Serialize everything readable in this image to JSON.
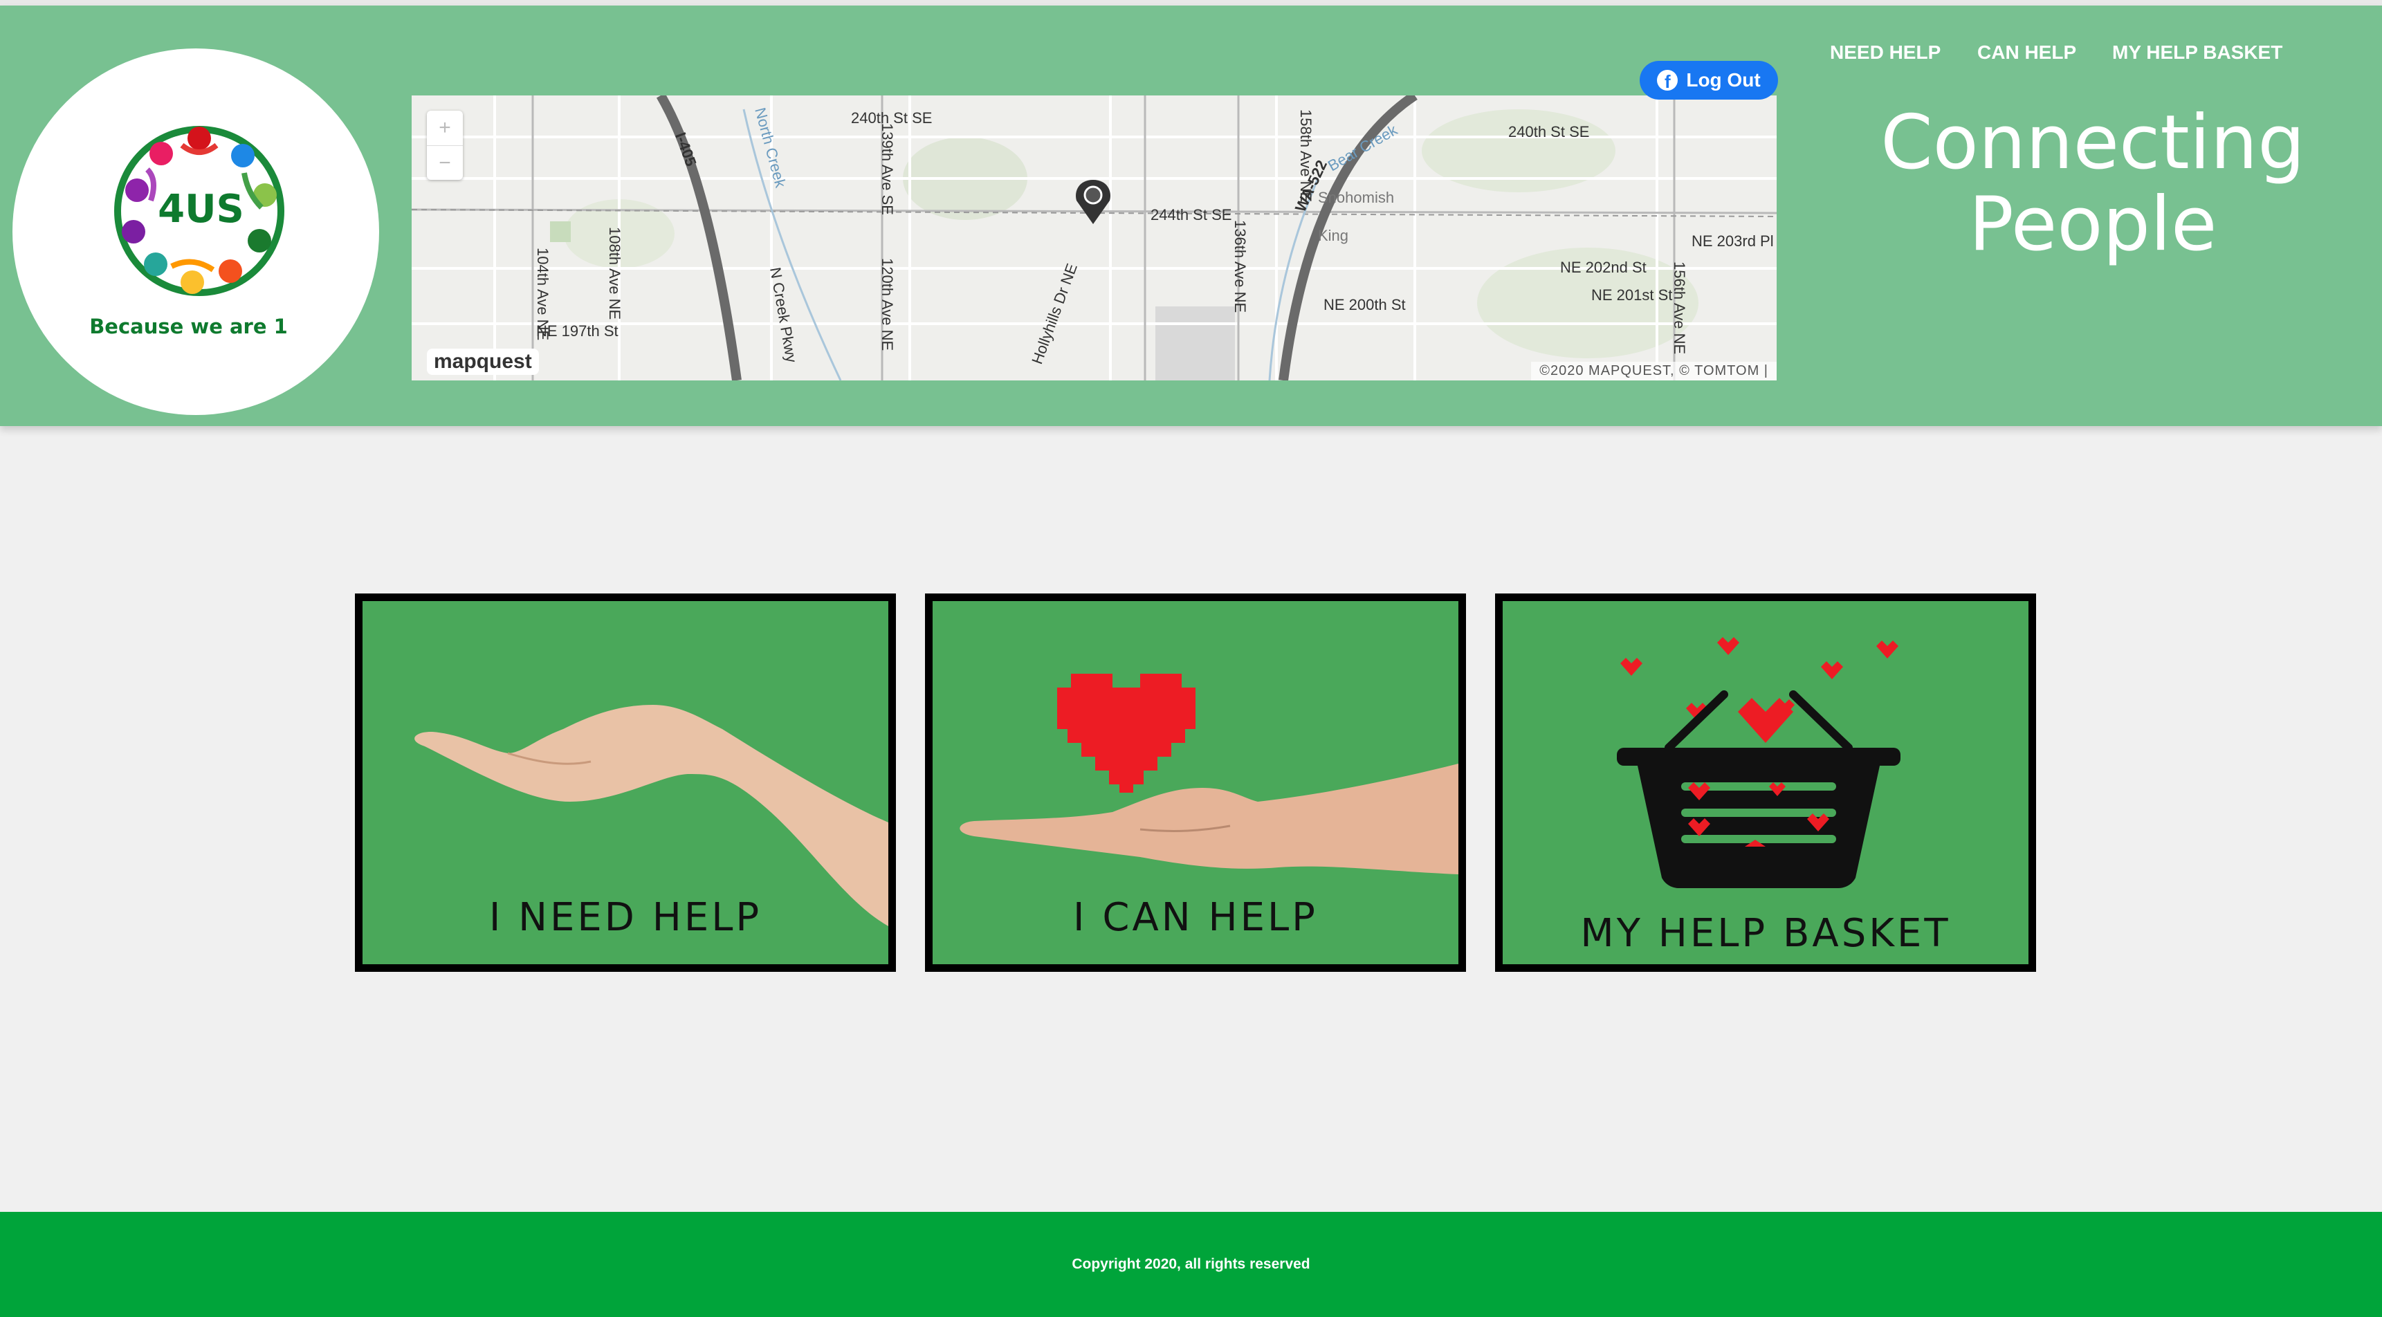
{
  "brand": {
    "logo_text": "4US",
    "tagline": "Because we are 1"
  },
  "nav": {
    "items": [
      "NEED HELP",
      "CAN HELP",
      "MY HELP BASKET"
    ]
  },
  "auth": {
    "logout_label": "Log Out",
    "logout_icon": "facebook-icon"
  },
  "headline": {
    "line1": "Connecting",
    "line2": "People"
  },
  "map": {
    "provider": "mapquest",
    "attribution": "©2020 MAPQUEST, © TOMTOM |",
    "zoom_in": "+",
    "zoom_out": "−",
    "labels": {
      "l1": "240th St SE",
      "l2": "240th St SE",
      "l3": "244th St SE",
      "l4": "I-405",
      "l5": "WA-522",
      "l6": "NE 203rd Pl",
      "l7": "NE 202nd St",
      "l8": "NE 201st St",
      "l9": "NE 200th St",
      "l10": "NE 197th St",
      "l11": "Snohomish",
      "l12": "King",
      "l13": "North Creek",
      "l14": "Bear Creek",
      "l15": "104th Ave NE",
      "l16": "108th Ave NE",
      "l17": "120th Ave NE",
      "l18": "136th Ave NE",
      "l19": "156th Ave NE",
      "l20": "139th Ave SE",
      "l21": "N Creek Pkwy",
      "l22": "Hollyhills Dr NE",
      "l23": "158th Ave NE"
    }
  },
  "cards": [
    {
      "label": "I NEED HELP",
      "icon": "open-hand-icon"
    },
    {
      "label": "I CAN HELP",
      "icon": "hand-with-heart-icon"
    },
    {
      "label": "MY HELP BASKET",
      "icon": "basket-hearts-icon"
    }
  ],
  "footer": {
    "copyright": "Copyright 2020, all rights reserved"
  },
  "colors": {
    "header_bg": "#78c191",
    "card_bg": "#4aa85a",
    "footer_bg": "#00a43a",
    "heart": "#ed1c24",
    "facebook": "#1877f2"
  }
}
